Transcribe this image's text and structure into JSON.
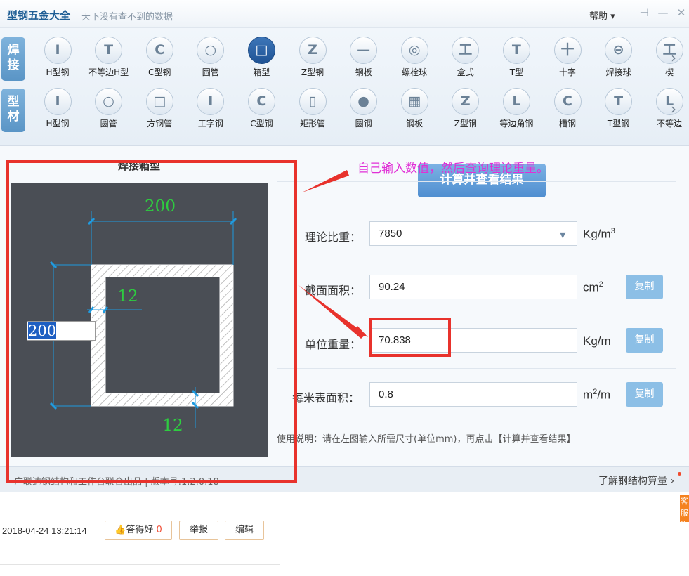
{
  "titlebar": {
    "app_name": "型钢五金大全",
    "slogan": "天下没有查不到的数据",
    "help": "帮助 ▾",
    "pin_icon": "⊣",
    "min_icon": "—",
    "close_icon": "✕"
  },
  "toolbar": {
    "cat_weld": "焊接",
    "cat_profile": "型材",
    "more": "›",
    "weld_items": [
      {
        "label": "H型钢",
        "glyph": "I"
      },
      {
        "label": "不等边H型",
        "glyph": "T"
      },
      {
        "label": "C型钢",
        "glyph": "C"
      },
      {
        "label": "圆管",
        "glyph": "○"
      },
      {
        "label": "箱型",
        "glyph": "□"
      },
      {
        "label": "Z型钢",
        "glyph": "Z"
      },
      {
        "label": "钢板",
        "glyph": "—"
      },
      {
        "label": "螺栓球",
        "glyph": "◎"
      },
      {
        "label": "盒式",
        "glyph": "工"
      },
      {
        "label": "T型",
        "glyph": "T"
      },
      {
        "label": "十字",
        "glyph": "十"
      },
      {
        "label": "焊接球",
        "glyph": "⊖"
      },
      {
        "label": "楔",
        "glyph": "工"
      }
    ],
    "profile_items": [
      {
        "label": "H型钢",
        "glyph": "I"
      },
      {
        "label": "圆管",
        "glyph": "○"
      },
      {
        "label": "方钢管",
        "glyph": "□"
      },
      {
        "label": "工字钢",
        "glyph": "I"
      },
      {
        "label": "C型钢",
        "glyph": "C"
      },
      {
        "label": "矩形管",
        "glyph": "▯"
      },
      {
        "label": "圆钢",
        "glyph": "●"
      },
      {
        "label": "钢板",
        "glyph": "▦"
      },
      {
        "label": "Z型钢",
        "glyph": "Z"
      },
      {
        "label": "等边角钢",
        "glyph": "L"
      },
      {
        "label": "槽钢",
        "glyph": "C"
      },
      {
        "label": "T型钢",
        "glyph": "T"
      },
      {
        "label": "不等边",
        "glyph": "L"
      }
    ]
  },
  "diagram": {
    "title": "焊接箱型",
    "dim_top": "200",
    "dim_left": "200",
    "dim_web": "12",
    "dim_flange": "12"
  },
  "form": {
    "calc_button": "计算并查看结果",
    "density_label": "理论比重：",
    "density_value": "7850",
    "density_unit": "Kg/m",
    "area_label": "截面面积：",
    "area_value": "90.24",
    "area_unit": "cm",
    "weight_label": "单位重量：",
    "weight_value": "70.838",
    "weight_unit": "Kg/m",
    "surface_label": "每米表面积：",
    "surface_value": "0.8",
    "surface_unit_a": "m",
    "surface_unit_b": "/m",
    "sup2": "2",
    "sup3": "3",
    "copy_label": "复制",
    "usage": "使用说明：请在左图输入所需尺寸(单位mm)，再点击【计算并查看结果】"
  },
  "statusbar": {
    "left": "广联达钢结构和工作台联合出品  |  版本号:1.2.0.18",
    "right": "了解钢结构算量",
    "right_arrow": "›"
  },
  "annotation": {
    "callout": "自己输入数值，然后查询理论重量。"
  },
  "web": {
    "time": "2018-04-24 13:21:14",
    "like_label": "答得好",
    "like_count": "0",
    "report": "举报",
    "edit": "编辑",
    "side_tab": "客服咨"
  },
  "colors": {
    "accent": "#1f5395",
    "highlight": "#e8322c",
    "callout": "#e02fd6",
    "dim_text": "#2ecc40",
    "dim_line": "#1f9be0"
  }
}
